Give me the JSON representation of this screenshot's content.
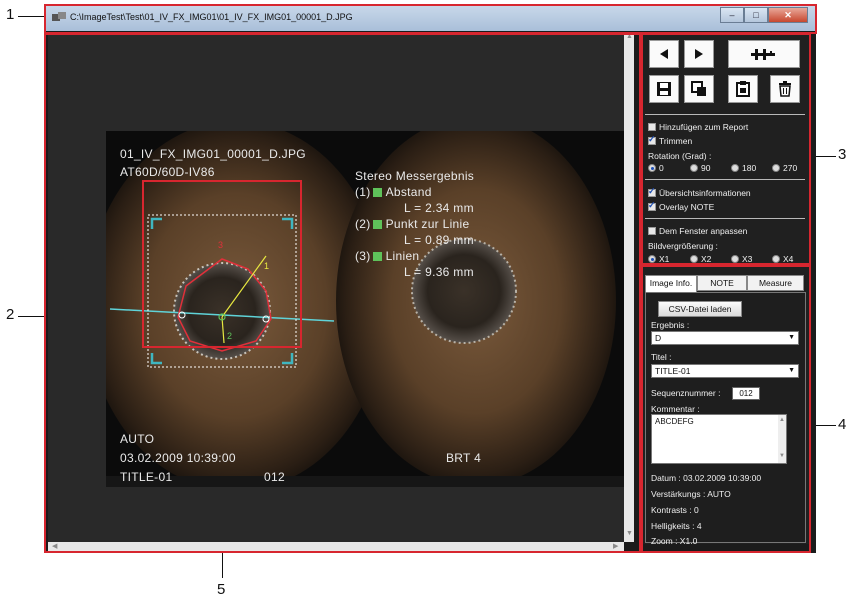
{
  "window": {
    "title": "C:\\ImageTest\\Test\\01_IV_FX_IMG01\\01_IV_FX_IMG01_00001_D.JPG",
    "minimize": "–",
    "maximize": "□",
    "close": "✕"
  },
  "callouts": [
    "1",
    "2",
    "3",
    "4",
    "5"
  ],
  "overlay": {
    "filename": "01_IV_FX_IMG01_00001_D.JPG",
    "model": "AT60D/60D-IV86",
    "measure_title": "Stereo Messergebnis",
    "results": [
      {
        "num": "(1)",
        "name": "Abstand",
        "value": "L = 2.34 mm"
      },
      {
        "num": "(2)",
        "name": "Punkt zur Linie",
        "value": "L = 0.89 mm"
      },
      {
        "num": "(3)",
        "name": "Linien",
        "value": "L = 9.36 mm"
      }
    ],
    "gain": "AUTO",
    "datetime": "03.02.2009  10:39:00",
    "title": "TITLE-01",
    "seq": "012",
    "brightness": "BRT 4",
    "marker_labels": [
      "3",
      "1",
      "2"
    ]
  },
  "panel": {
    "toolbar": {
      "prev": "prev-icon",
      "next": "next-icon",
      "measure": "measure-icon",
      "save": "save-icon",
      "copy": "copy-icon",
      "clipboard": "clipboard-icon",
      "delete": "delete-icon"
    },
    "options": {
      "add_report": "Hinzufügen zum Report",
      "trim": "Trimmen",
      "rotation_label": "Rotation (Grad) :",
      "rotation": [
        "0",
        "90",
        "180",
        "270"
      ],
      "overview": "Übersichtsinformationen",
      "overlay": "Overlay NOTE",
      "fit": "Dem Fenster anpassen",
      "zoom_label": "Bildvergrößerung :",
      "zoom": [
        "X1",
        "X2",
        "X3",
        "X4"
      ]
    },
    "tabs": [
      "Image Info.",
      "NOTE",
      "Measure"
    ],
    "info": {
      "csv_button": "CSV-Datei laden",
      "result_label": "Ergebnis :",
      "result_value": "D",
      "title_label": "Titel :",
      "title_value": "TITLE-01",
      "seq_label": "Sequenznummer :",
      "seq_value": "012",
      "comment_label": "Kommentar :",
      "comment_value": "ABCDEFG",
      "date": "Datum : 03.02.2009 10:39:00",
      "gain": "Verstärkungs : AUTO",
      "contrast": "Kontrasts : 0",
      "brightness": "Helligkeits : 4",
      "zoom": "Zoom : X1.0"
    }
  },
  "colors": {
    "callout_box": "#d7262f",
    "marker_green": "#5fc25a",
    "corner_bracket": "#3fb6c0"
  }
}
